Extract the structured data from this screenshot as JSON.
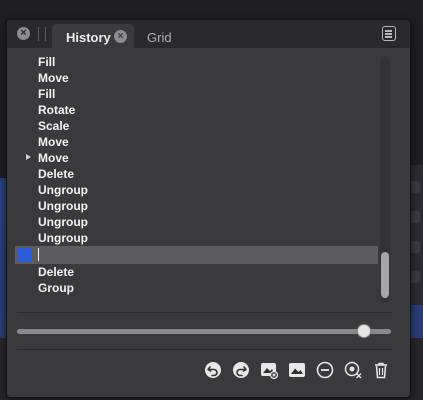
{
  "panel": {
    "tabs": [
      {
        "label": "History",
        "active": true
      },
      {
        "label": "Grid",
        "active": false
      }
    ]
  },
  "history": {
    "items": [
      {
        "label": "Fill"
      },
      {
        "label": "Move"
      },
      {
        "label": "Fill"
      },
      {
        "label": "Rotate"
      },
      {
        "label": "Scale"
      },
      {
        "label": "Move"
      },
      {
        "label": "Move",
        "expandable": true
      },
      {
        "label": "Delete"
      },
      {
        "label": "Ungroup"
      },
      {
        "label": "Ungroup"
      },
      {
        "label": "Ungroup"
      },
      {
        "label": "Ungroup"
      },
      {
        "label": "",
        "selected": true,
        "editing": true
      },
      {
        "label": "Delete"
      },
      {
        "label": "Group"
      }
    ],
    "selected_index": 12,
    "scroll_position": 0.92
  },
  "slider": {
    "value": 0.94
  },
  "toolbar": {
    "icons": [
      "undo-icon",
      "redo-icon",
      "snapshot-add-icon",
      "snapshot-icon",
      "remove-icon",
      "remove-all-icon",
      "trash-icon"
    ]
  },
  "colors": {
    "panel_bg": "#3a3a3c",
    "selection": "#5c5c5e",
    "swatch": "#2c5cd6",
    "text": "#f2f2f2"
  }
}
